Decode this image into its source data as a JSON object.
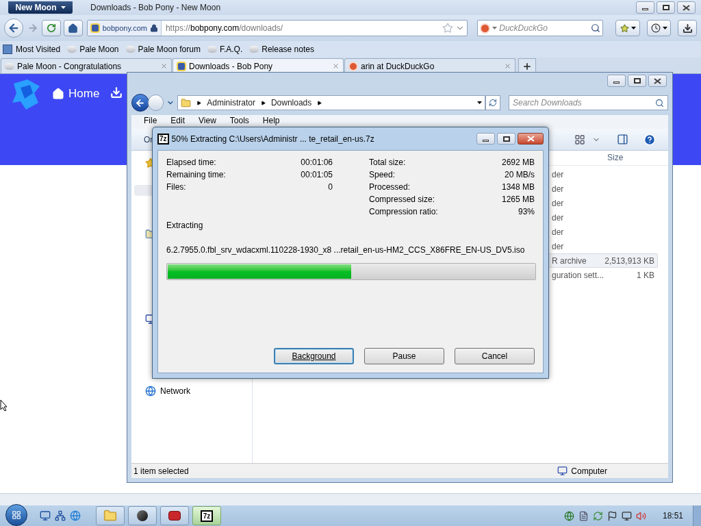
{
  "browser": {
    "app_button": "New Moon",
    "title": "Downloads - Bob Pony - New Moon",
    "site_identity": "bobpony.com",
    "url_prefix": "https://",
    "url_host": "bobpony.com",
    "url_path": "/downloads/",
    "search_placeholder": "DuckDuckGo"
  },
  "bookmarks": [
    {
      "label": "Most Visited",
      "kind": "folder"
    },
    {
      "label": "Pale Moon",
      "kind": "page"
    },
    {
      "label": "Pale Moon forum",
      "kind": "page"
    },
    {
      "label": "F.A.Q.",
      "kind": "page"
    },
    {
      "label": "Release notes",
      "kind": "page"
    }
  ],
  "tabs": [
    {
      "label": "Pale Moon - Congratulations",
      "kind": "page",
      "selected": false
    },
    {
      "label": "Downloads - Bob Pony",
      "kind": "site",
      "selected": true
    },
    {
      "label": "arin at DuckDuckGo",
      "kind": "duck",
      "selected": false
    }
  ],
  "page": {
    "nav_label": "Home"
  },
  "explorer": {
    "breadcrumbs": [
      "Administrator",
      "Downloads"
    ],
    "search_placeholder": "Search Downloads",
    "menu": [
      "File",
      "Edit",
      "View",
      "Tools",
      "Help"
    ],
    "toolbar_partial": "Or",
    "size_header": "Size",
    "rows": [
      {
        "name": "der",
        "selected": false
      },
      {
        "name": "der",
        "selected": false
      },
      {
        "name": "der",
        "selected": false
      },
      {
        "name": "der",
        "selected": false
      },
      {
        "name": "der",
        "selected": false
      },
      {
        "name": "der",
        "selected": false
      },
      {
        "name": "R archive",
        "size": "2,513,913 KB",
        "selected": true
      },
      {
        "name": "guration sett...",
        "size": "1 KB",
        "selected": false
      }
    ],
    "network": "Network",
    "status": "1 item selected",
    "location": "Computer"
  },
  "dialog": {
    "icon_text": "7z",
    "title": "50% Extracting C:\\Users\\Administr ... te_retail_en-us.7z",
    "stats_left": [
      {
        "label": "Elapsed time:",
        "value": "00:01:06"
      },
      {
        "label": "Remaining time:",
        "value": "00:01:05"
      },
      {
        "label": "Files:",
        "value": "0"
      }
    ],
    "stats_right": [
      {
        "label": "Total size:",
        "value": "2692 MB"
      },
      {
        "label": "Speed:",
        "value": "20 MB/s"
      },
      {
        "label": "Processed:",
        "value": "1348 MB"
      },
      {
        "label": "Compressed size:",
        "value": "1265 MB"
      },
      {
        "label": "Compression ratio:",
        "value": "93%"
      }
    ],
    "status": "Extracting",
    "file": "6.2.7955.0.fbl_srv_wdacxml.110228-1930_x8 ...retail_en-us-HM2_CCS_X86FRE_EN-US_DV5.iso",
    "level": 0.5,
    "buttons": [
      {
        "label": "Background",
        "default": true
      },
      {
        "label": "Pause",
        "default": false
      },
      {
        "label": "Cancel",
        "default": false
      }
    ]
  },
  "taskbar": {
    "tasks": [
      {
        "kind": "explorer",
        "selected": false
      },
      {
        "kind": "browser",
        "selected": false
      },
      {
        "kind": "app",
        "selected": false
      },
      {
        "kind": "archiver",
        "icon_text": "7z",
        "selected": true
      }
    ],
    "clock": "18:51"
  }
}
